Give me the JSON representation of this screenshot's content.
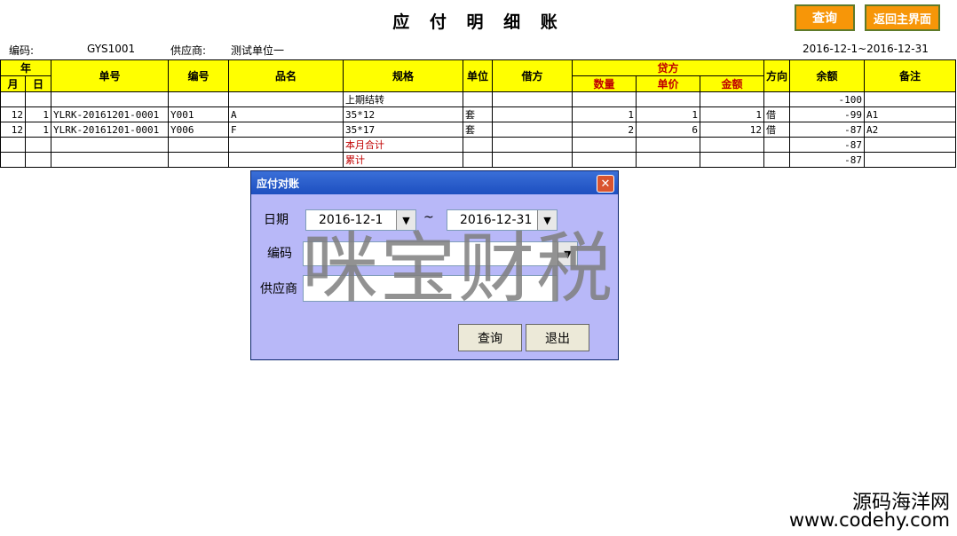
{
  "header": {
    "title": "应 付 明 细 账",
    "query_button": "查询",
    "home_button": "返回主界面"
  },
  "info": {
    "code_label": "编码:",
    "code_value": "GYS1001",
    "supplier_label": "供应商:",
    "supplier_value": "测试单位一",
    "date_range": "2016-12-1~2016-12-31"
  },
  "table": {
    "headers": {
      "year": "年",
      "month": "月",
      "day": "日",
      "doc_no": "单号",
      "item_code": "编号",
      "item_name": "品名",
      "spec": "规格",
      "unit": "单位",
      "debit": "借方",
      "credit": "贷方",
      "qty": "数量",
      "price": "单价",
      "amount": "金额",
      "direction": "方向",
      "balance": "余额",
      "remark": "备注"
    },
    "rows": [
      {
        "month": "",
        "day": "",
        "doc_no": "",
        "item_code": "",
        "item_name": "",
        "spec": "上期结转",
        "unit": "",
        "debit": "",
        "qty": "",
        "price": "",
        "amount": "",
        "direction": "",
        "balance": "-100",
        "remark": ""
      },
      {
        "month": "12",
        "day": "1",
        "doc_no": "YLRK-20161201-0001",
        "item_code": "Y001",
        "item_name": "A",
        "spec": "35*12",
        "unit": "套",
        "debit": "",
        "qty": "1",
        "price": "1",
        "amount": "1",
        "direction": "借",
        "balance": "-99",
        "remark": "A1"
      },
      {
        "month": "12",
        "day": "1",
        "doc_no": "YLRK-20161201-0001",
        "item_code": "Y006",
        "item_name": "F",
        "spec": "35*17",
        "unit": "套",
        "debit": "",
        "qty": "2",
        "price": "6",
        "amount": "12",
        "direction": "借",
        "balance": "-87",
        "remark": "A2"
      },
      {
        "month": "",
        "day": "",
        "doc_no": "",
        "item_code": "",
        "item_name": "",
        "spec": "本月合计",
        "unit": "",
        "debit": "",
        "qty": "",
        "price": "",
        "amount": "",
        "direction": "",
        "balance": "-87",
        "remark": ""
      },
      {
        "month": "",
        "day": "",
        "doc_no": "",
        "item_code": "",
        "item_name": "",
        "spec": "累计",
        "unit": "",
        "debit": "",
        "qty": "",
        "price": "",
        "amount": "",
        "direction": "",
        "balance": "-87",
        "remark": ""
      }
    ]
  },
  "dialog": {
    "title": "应付对账",
    "date_label": "日期",
    "date_from": "2016-12-1",
    "date_sep": "~",
    "date_to": "2016-12-31",
    "code_label": "编码",
    "code_value": "",
    "supplier_label": "供应商",
    "supplier_value": "",
    "query_button": "查询",
    "exit_button": "退出"
  },
  "watermark": "咪宝财税",
  "site": {
    "name": "源码海洋网",
    "url": "www.codehy.com"
  },
  "colors": {
    "header_fill": "#ffff00",
    "button_orange": "#f79608",
    "dialog_bg": "#b8b8f8",
    "dialog_titlebar": "#1d4fc0",
    "red_text": "#c00000"
  }
}
